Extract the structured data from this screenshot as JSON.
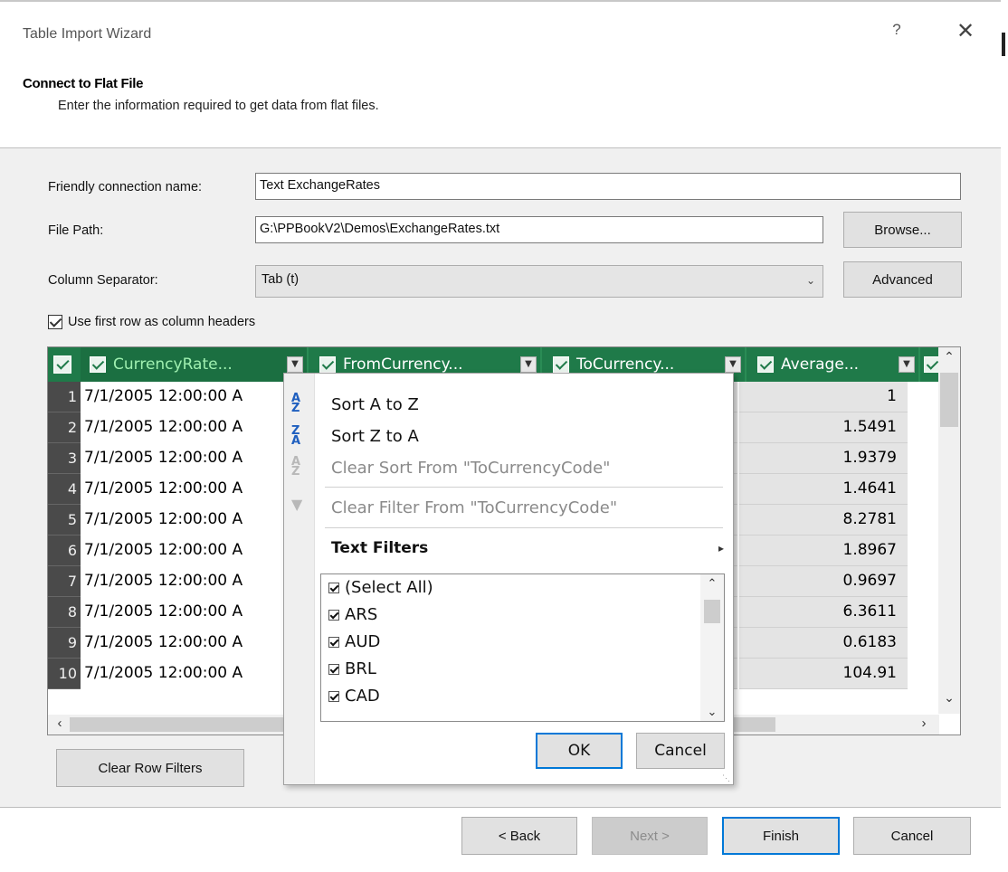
{
  "window": {
    "title": "Table Import Wizard",
    "help_glyph": "?",
    "close_glyph": "✕"
  },
  "header": {
    "heading": "Connect to Flat File",
    "description": "Enter the information required to get data from flat files."
  },
  "form": {
    "friendly_name_label": "Friendly connection name:",
    "friendly_name_value": "Text ExchangeRates",
    "file_path_label": "File Path:",
    "file_path_value": "G:\\PPBookV2\\Demos\\ExchangeRates.txt",
    "browse_label": "Browse...",
    "separator_label": "Column Separator:",
    "separator_value": "Tab (t)",
    "advanced_label": "Advanced",
    "first_row_header_label": "Use first row as column headers",
    "first_row_header_checked": true
  },
  "grid": {
    "columns": [
      {
        "label": "CurrencyRate...",
        "checked": true
      },
      {
        "label": "FromCurrency...",
        "checked": true
      },
      {
        "label": "ToCurrency...",
        "checked": true
      },
      {
        "label": "Average...",
        "checked": true
      }
    ],
    "rows": [
      {
        "num": "1",
        "date": "7/1/2005 12:00:00 A",
        "average": "1"
      },
      {
        "num": "2",
        "date": "7/1/2005 12:00:00 A",
        "average": "1.5491"
      },
      {
        "num": "3",
        "date": "7/1/2005 12:00:00 A",
        "average": "1.9379"
      },
      {
        "num": "4",
        "date": "7/1/2005 12:00:00 A",
        "average": "1.4641"
      },
      {
        "num": "5",
        "date": "7/1/2005 12:00:00 A",
        "average": "8.2781"
      },
      {
        "num": "6",
        "date": "7/1/2005 12:00:00 A",
        "average": "1.8967"
      },
      {
        "num": "7",
        "date": "7/1/2005 12:00:00 A",
        "average": "0.9697"
      },
      {
        "num": "8",
        "date": "7/1/2005 12:00:00 A",
        "average": "6.3611"
      },
      {
        "num": "9",
        "date": "7/1/2005 12:00:00 A",
        "average": "0.6183"
      },
      {
        "num": "10",
        "date": "7/1/2005 12:00:00 A",
        "average": "104.91"
      }
    ],
    "header_color": "#1f7a49"
  },
  "filter_popup": {
    "sort_asc": "Sort A to Z",
    "sort_desc": "Sort Z to A",
    "clear_sort": "Clear Sort From \"ToCurrencyCode\"",
    "clear_filter": "Clear Filter From \"ToCurrencyCode\"",
    "text_filters": "Text Filters",
    "list_items": [
      "(Select All)",
      "ARS",
      "AUD",
      "BRL",
      "CAD"
    ],
    "ok_label": "OK",
    "cancel_label": "Cancel"
  },
  "clear_row_filters_label": "Clear Row Filters",
  "footer": {
    "back_label": "< Back",
    "next_label": "Next >",
    "finish_label": "Finish",
    "cancel_label": "Cancel"
  },
  "accent_color": "#0078d7"
}
